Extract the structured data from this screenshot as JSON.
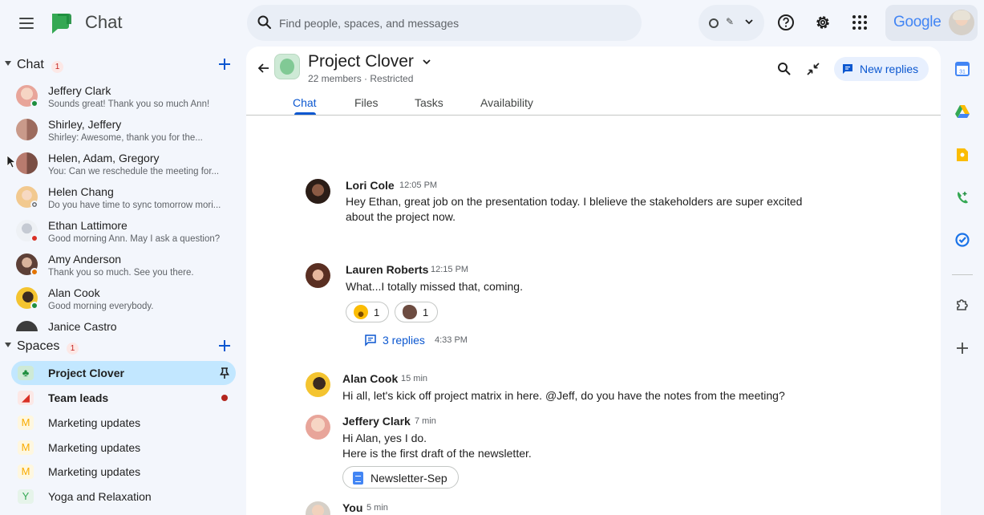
{
  "app": {
    "title": "Chat",
    "logo_icon": "google-chat-logo",
    "accent": "#0b57d0",
    "active_bg": "#c2e7ff"
  },
  "search": {
    "placeholder": "Find people, spaces, and messages",
    "value": ""
  },
  "topbar": {
    "status_icon": "status-dot-icon",
    "help_icon": "help-icon",
    "settings_icon": "gear-icon",
    "apps_icon": "apps-grid-icon",
    "account_brand": "Google"
  },
  "sidebar": {
    "chat_section": {
      "title": "Chat",
      "badge": "1",
      "items": [
        {
          "name": "Jeffery Clark",
          "snippet": "Sounds great! Thank you so much Ann!",
          "presence": "online",
          "avatar_color": "#e8a59a"
        },
        {
          "name": "Shirley, Jeffery",
          "snippet": "Shirley: Awesome, thank you for the...",
          "presence": "",
          "avatar_color": "#c99a8a"
        },
        {
          "name": "Helen, Adam, Gregory",
          "snippet": "You: Can we reschedule the meeting for...",
          "presence": "",
          "avatar_color": "#b87b6e"
        },
        {
          "name": "Helen Chang",
          "snippet": "Do you have time to sync tomorrow mori...",
          "presence": "away",
          "avatar_color": "#f2c98f"
        },
        {
          "name": "Ethan Lattimore",
          "snippet": "Good morning Ann. May I ask a question?",
          "presence": "busy",
          "avatar_color": "#dfe3ea"
        },
        {
          "name": "Amy Anderson",
          "snippet": "Thank you so much. See you there.",
          "presence": "away-clock",
          "avatar_color": "#8d6e63"
        },
        {
          "name": "Alan Cook",
          "snippet": "Good morning everybody.",
          "presence": "online",
          "avatar_color": "#f4c430"
        },
        {
          "name": "Janice Castro",
          "snippet": "",
          "presence": "",
          "avatar_color": "#3c3c3c"
        }
      ]
    },
    "spaces_section": {
      "title": "Spaces",
      "badge": "1",
      "items": [
        {
          "name": "Project Clover",
          "icon": "clover-icon",
          "letter": "",
          "active": true,
          "pinned": true
        },
        {
          "name": "Team leads",
          "icon": "megaphone-icon",
          "letter": "",
          "unread": true
        },
        {
          "name": "Marketing updates",
          "icon": "letter-m-icon",
          "letter": "M"
        },
        {
          "name": "Marketing updates",
          "icon": "letter-m-icon",
          "letter": "M"
        },
        {
          "name": "Marketing updates",
          "icon": "letter-m-icon",
          "letter": "M"
        },
        {
          "name": "Yoga and Relaxation",
          "icon": "letter-y-icon",
          "letter": "Y"
        }
      ]
    }
  },
  "conversation": {
    "title": "Project Clover",
    "subtitle": "22 members · Restricted",
    "new_replies_label": "New replies",
    "tabs": [
      {
        "label": "Chat",
        "active": true
      },
      {
        "label": "Files"
      },
      {
        "label": "Tasks"
      },
      {
        "label": "Availability"
      }
    ],
    "messages": [
      {
        "sender": "Lori Cole",
        "time": "12:05 PM",
        "lines": [
          "Hey Ethan, great job on the presentation today. I blelieve the stakeholders are super excited",
          "about the project now."
        ]
      },
      {
        "sender": "Lauren Roberts",
        "time": "12:15 PM",
        "lines": [
          "What...I totally missed that, coming."
        ],
        "reactions": [
          {
            "emoji": "grinning-face-icon",
            "count": "1"
          },
          {
            "emoji": "clapping-hands-icon",
            "count": "1"
          }
        ],
        "thread": {
          "replies_label": "3 replies",
          "time": "4:33 PM"
        }
      },
      {
        "sender": "Alan Cook",
        "time": "15 min",
        "lines": [
          "Hi all, let's kick off project matrix in here. @Jeff, do you have the notes from the meeting?"
        ]
      },
      {
        "sender": "Jeffery Clark",
        "time": "7 min",
        "lines": [
          "Hi Alan, yes I do.",
          "Here is the first draft of the newsletter."
        ],
        "attachment": {
          "label": "Newsletter-Sep",
          "icon": "google-docs-icon"
        }
      },
      {
        "sender": "You",
        "time": "5 min",
        "lines": []
      }
    ]
  },
  "right_rail": {
    "icons": [
      "calendar-icon",
      "drive-icon",
      "keep-icon",
      "voice-icon",
      "tasks-icon",
      "addons-icon",
      "add-icon"
    ]
  }
}
